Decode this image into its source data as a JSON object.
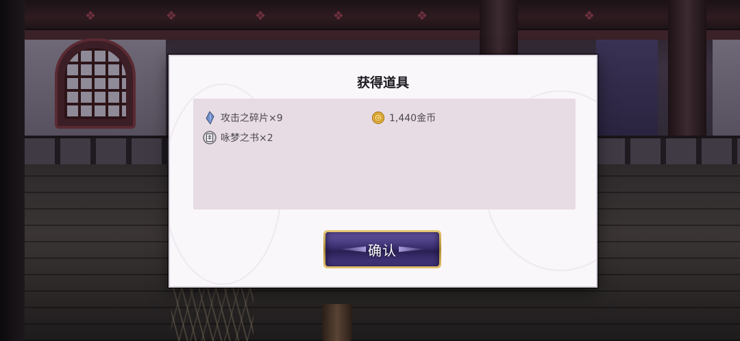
{
  "dialog": {
    "title": "获得道具",
    "rewards": [
      {
        "icon": "crystal-shard-icon",
        "label": "攻击之碎片×9"
      },
      {
        "icon": "book-icon",
        "label": "咏梦之书×2"
      },
      {
        "icon": "gold-coin-icon",
        "label": "1,440金币"
      }
    ],
    "confirm_label": "确认"
  },
  "colors": {
    "dialog_bg": "#faf7fb",
    "reward_box_bg": "#e7dce3",
    "button_gold": "#e8c978",
    "button_purple": "#3a2e6e"
  }
}
